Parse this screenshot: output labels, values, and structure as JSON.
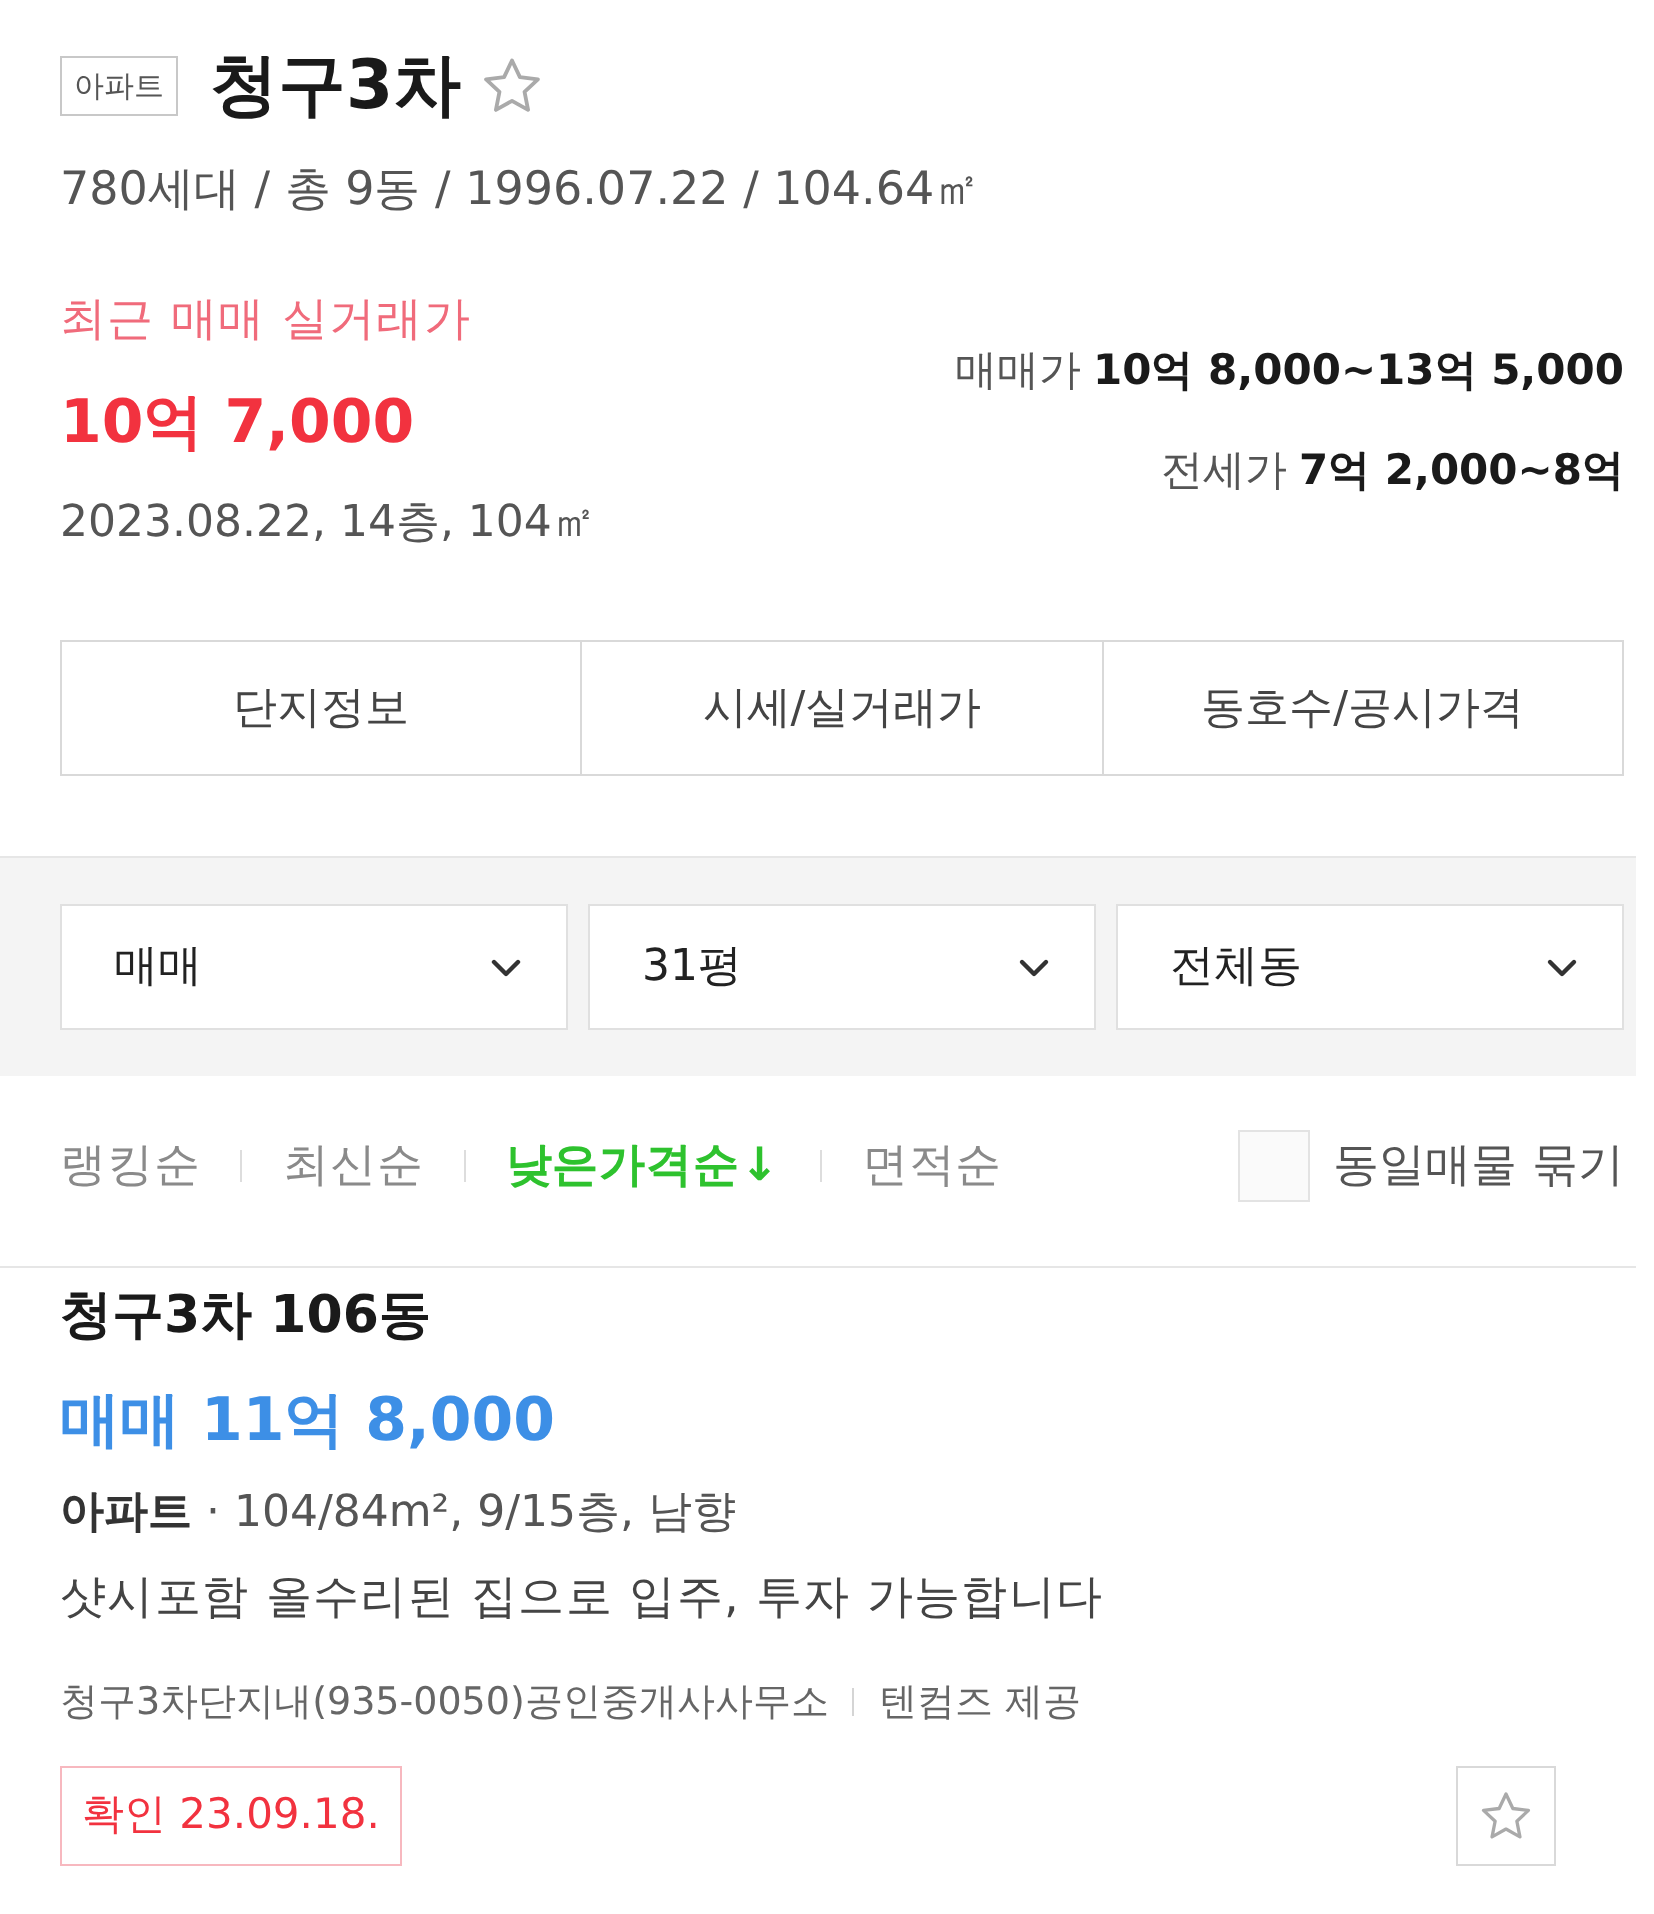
{
  "complex": {
    "type_badge": "아파트",
    "name": "청구3차",
    "favorited": false,
    "summary": "780세대 / 총 9동 / 1996.07.22 / 104.64㎡"
  },
  "recent_trade": {
    "label": "최근 매매 실거래가",
    "price": "10억 7,000",
    "detail": "2023.08.22, 14층, 104㎡"
  },
  "price_ranges": [
    {
      "label": "매매가",
      "value": "10억 8,000~13억 5,000"
    },
    {
      "label": "전세가",
      "value": "7억 2,000~8억"
    }
  ],
  "tabs": [
    {
      "label": "단지정보",
      "selected": false
    },
    {
      "label": "시세/실거래가",
      "selected": false
    },
    {
      "label": "동호수/공시가격",
      "selected": false
    }
  ],
  "filters": [
    {
      "value": "매매"
    },
    {
      "value": "31평"
    },
    {
      "value": "전체동"
    }
  ],
  "sort_options": [
    {
      "label": "랭킹순",
      "selected": false
    },
    {
      "label": "최신순",
      "selected": false
    },
    {
      "label": "낮은가격순↓",
      "selected": true
    },
    {
      "label": "면적순",
      "selected": false
    }
  ],
  "group_same_listings": {
    "label": "동일매물 묶기",
    "checked": false
  },
  "listings": [
    {
      "title": "청구3차 106동",
      "price": "매매 11억 8,000",
      "specs": "**아파트** · 104/84m², 9/15층, 남향",
      "description": "샷시포함 올수리된 집으로 입주, 투자 가능합니다",
      "agent": "청구3차단지내(935-0050)공인중개사사무소",
      "provider": "텐컴즈 제공",
      "verified": "확인 23.09.18.",
      "favorited": false
    }
  ]
}
